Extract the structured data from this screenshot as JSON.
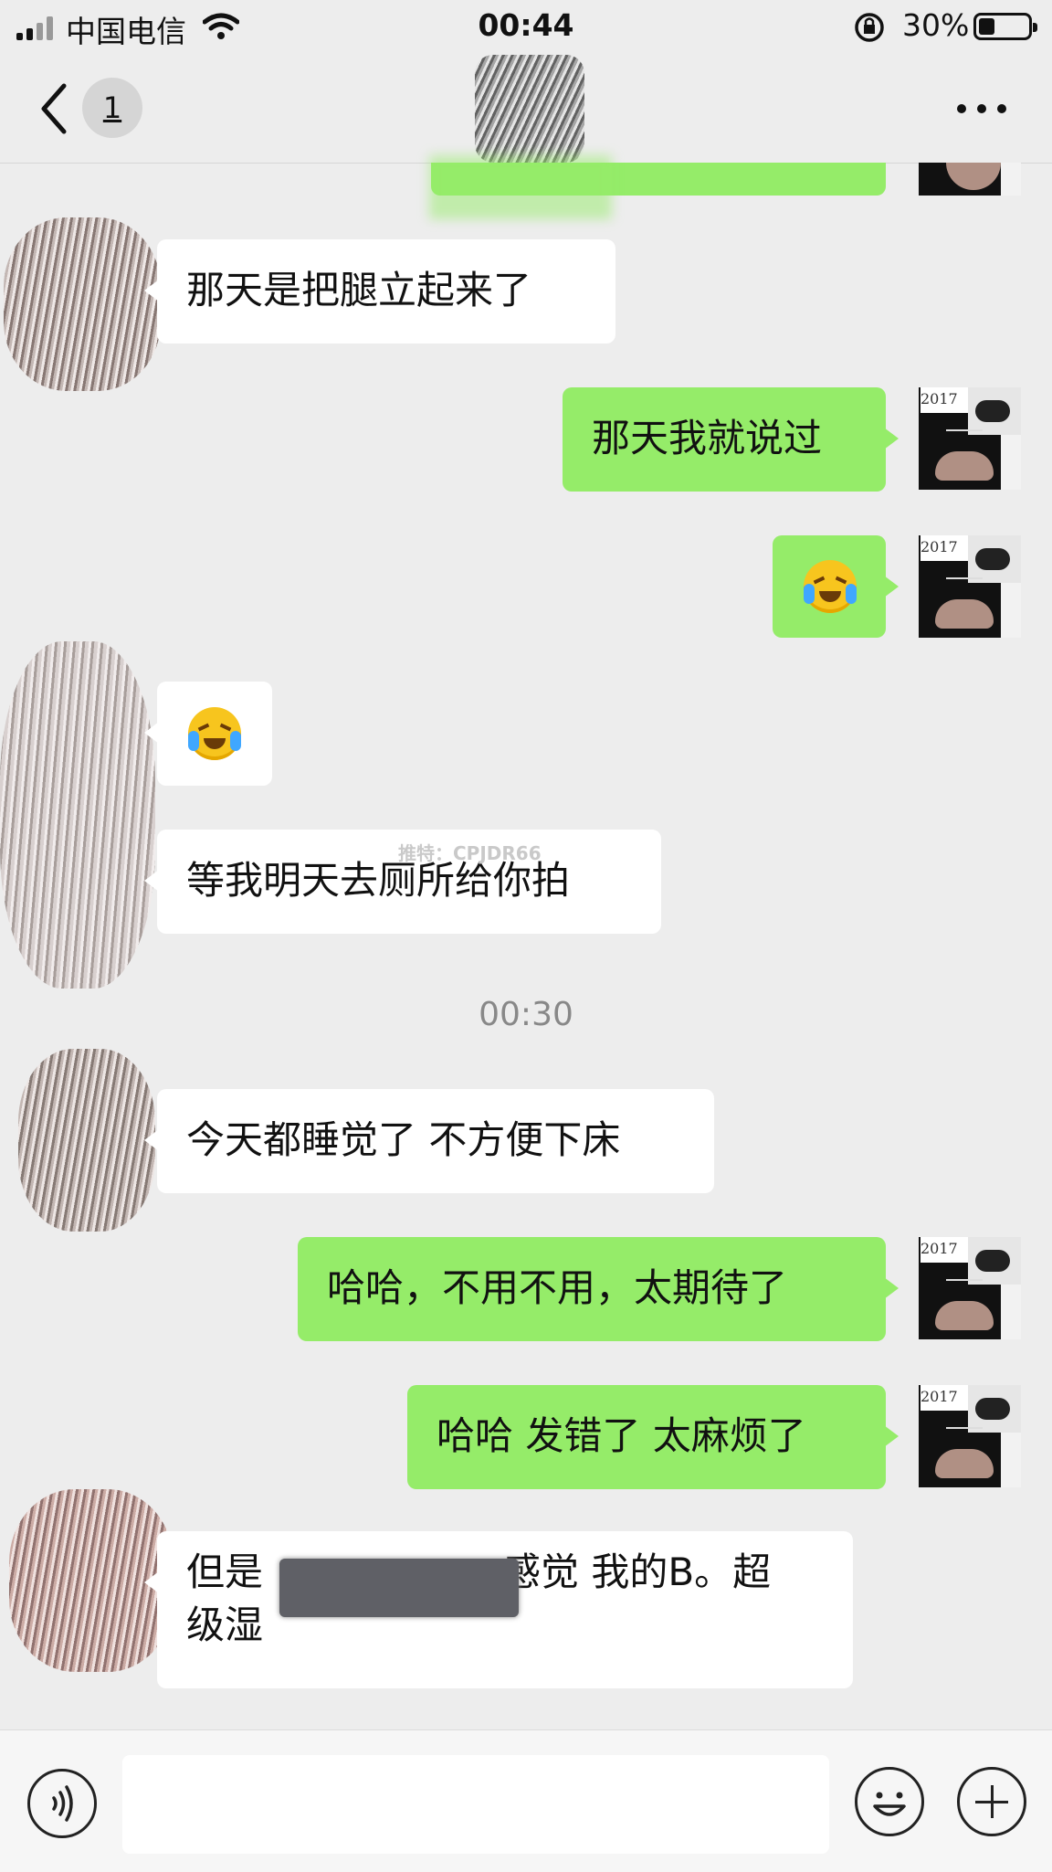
{
  "status_bar": {
    "carrier": "中国电信",
    "time": "00:44",
    "battery": "30%"
  },
  "nav": {
    "unread_count": "1",
    "back_icon": "chevron-left-icon",
    "more_icon": "more-dots-icon"
  },
  "watermark": "推特：CPJDR66",
  "avatar_me_label": "2017",
  "messages": [
    {
      "side": "in",
      "text": "那天是把腿立起来了"
    },
    {
      "side": "out",
      "text": "那天我就说过"
    },
    {
      "side": "out",
      "type": "emoji",
      "emoji": "face-with-tears-icon"
    },
    {
      "side": "in",
      "type": "emoji",
      "emoji": "face-with-tears-icon"
    },
    {
      "side": "in",
      "text": "等我明天去厕所给你拍"
    },
    {
      "side": "time",
      "text": "00:30"
    },
    {
      "side": "in",
      "text": "今天都睡觉了 不方便下床"
    },
    {
      "side": "out",
      "text": "哈哈，不用不用，太期待了"
    },
    {
      "side": "out",
      "text": "哈哈 发错了 太麻烦了"
    },
    {
      "side": "in",
      "text_part1": "但是",
      "text_part2": "感觉 我的B。超",
      "text_line2": "级湿"
    }
  ],
  "toolbar": {
    "voice_icon": "voice-icon",
    "emoji_icon": "emoji-smile-icon",
    "plus_icon": "plus-circle-icon",
    "input_placeholder": ""
  },
  "colors": {
    "background": "#ededed",
    "bubble_out": "#95ec69",
    "bubble_in": "#ffffff"
  }
}
